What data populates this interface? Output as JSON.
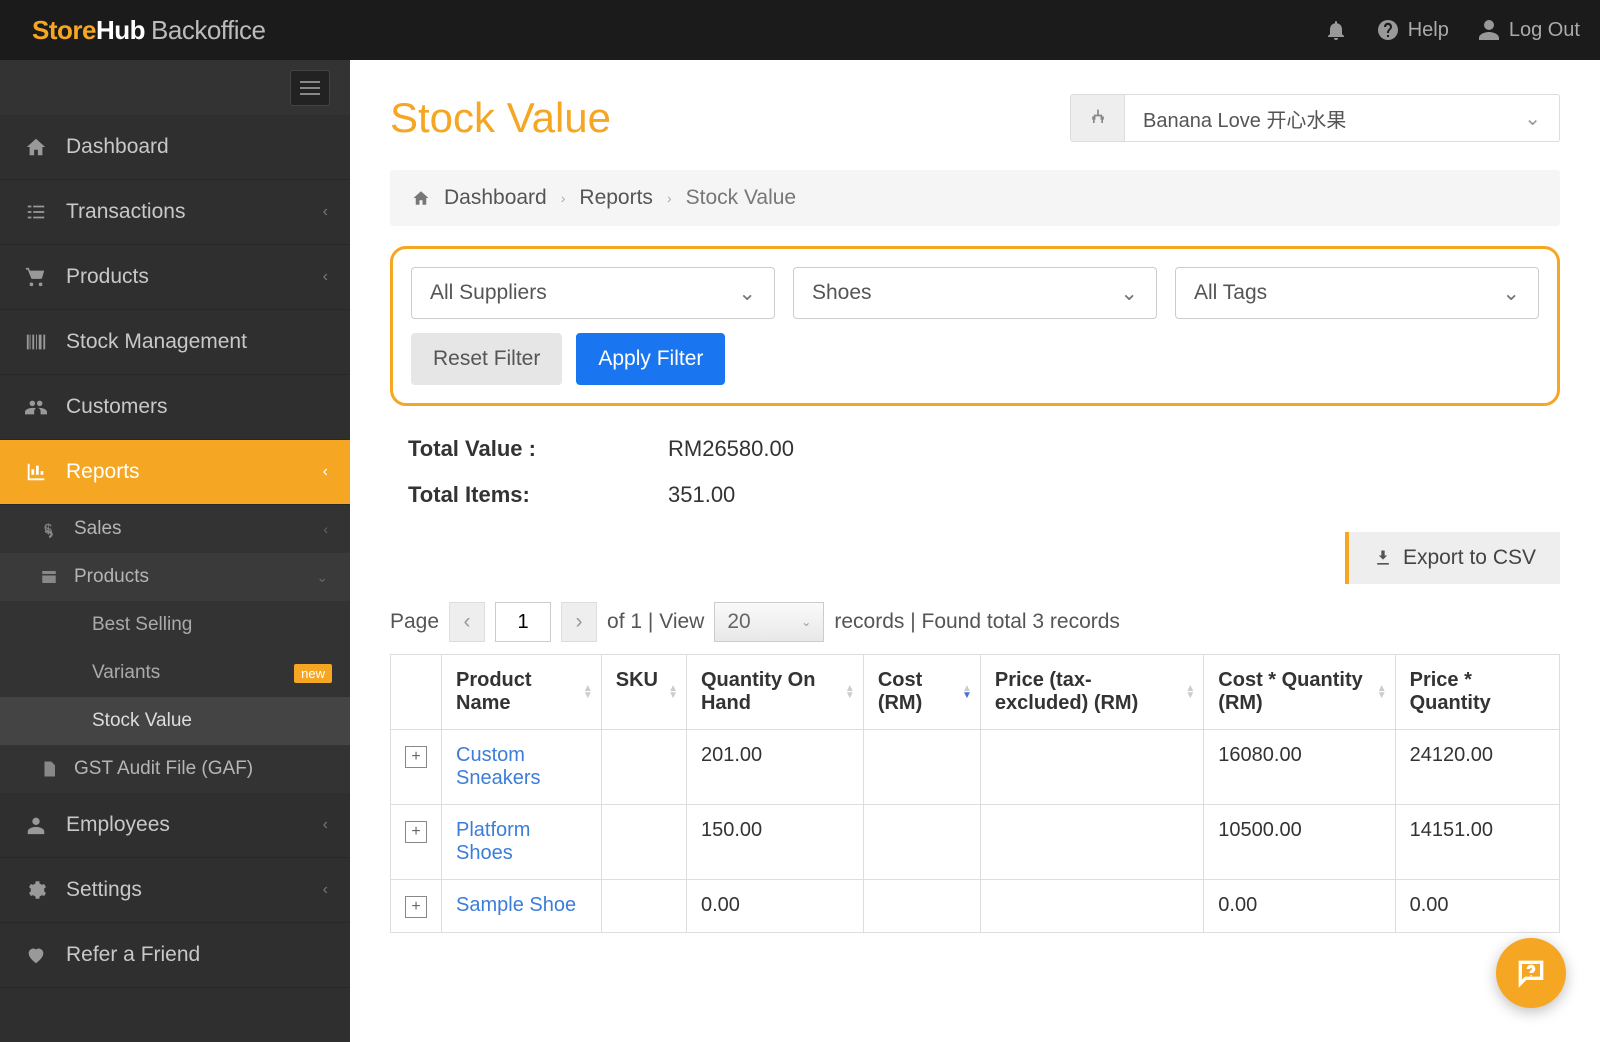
{
  "brand": {
    "part1": "Store",
    "part2": "Hub",
    "suffix": "Backoffice"
  },
  "topbar": {
    "help": "Help",
    "logout": "Log Out"
  },
  "sidebar": {
    "dashboard": "Dashboard",
    "transactions": "Transactions",
    "products": "Products",
    "stock": "Stock Management",
    "customers": "Customers",
    "reports": "Reports",
    "employees": "Employees",
    "settings": "Settings",
    "refer": "Refer a Friend",
    "sub": {
      "sales": "Sales",
      "products": "Products",
      "best_selling": "Best Selling",
      "variants": "Variants",
      "variants_badge": "new",
      "stock_value": "Stock Value",
      "gst": "GST Audit File (GAF)"
    }
  },
  "page": {
    "title": "Stock Value",
    "store": "Banana Love 开心水果"
  },
  "breadcrumb": {
    "dashboard": "Dashboard",
    "reports": "Reports",
    "stock_value": "Stock Value"
  },
  "filters": {
    "suppliers": "All Suppliers",
    "category": "Shoes",
    "tags": "All Tags",
    "reset": "Reset Filter",
    "apply": "Apply Filter"
  },
  "totals": {
    "value_label": "Total Value :",
    "value": "RM26580.00",
    "items_label": "Total Items:",
    "items": "351.00"
  },
  "export_label": "Export to CSV",
  "pager": {
    "page_label": "Page",
    "current": "1",
    "of_text": "of 1 | View",
    "per_page": "20",
    "records_text": "records | Found total 3 records"
  },
  "table": {
    "headers": {
      "product": "Product Name",
      "sku": "SKU",
      "qoh": "Quantity On Hand",
      "cost": "Cost (RM)",
      "price_ex": "Price (tax-excluded) (RM)",
      "cost_x_qty": "Cost * Quantity (RM)",
      "price_x_qty": "Price * Quantity"
    },
    "rows": [
      {
        "product": "Custom Sneakers",
        "sku": "",
        "qoh": "201.00",
        "cost": "",
        "price_ex": "",
        "cost_x_qty": "16080.00",
        "price_x_qty": "24120.00"
      },
      {
        "product": "Platform Shoes",
        "sku": "",
        "qoh": "150.00",
        "cost": "",
        "price_ex": "",
        "cost_x_qty": "10500.00",
        "price_x_qty": "14151.00"
      },
      {
        "product": "Sample Shoe",
        "sku": "",
        "qoh": "0.00",
        "cost": "",
        "price_ex": "",
        "cost_x_qty": "0.00",
        "price_x_qty": "0.00"
      }
    ]
  }
}
